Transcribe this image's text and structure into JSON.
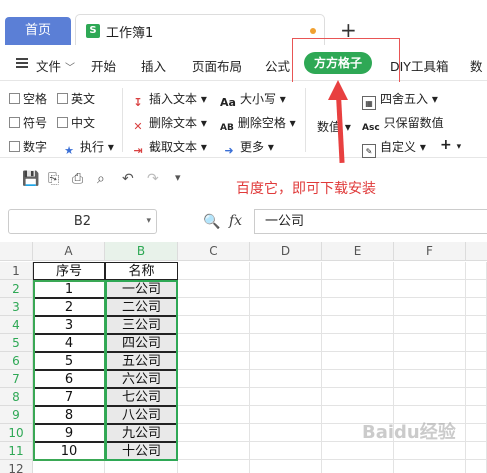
{
  "tabs": {
    "home": "首页",
    "doc_title": "工作簿1",
    "doc_icon": "S"
  },
  "menu": {
    "items": [
      "文件",
      "开始",
      "插入",
      "页面布局",
      "公式",
      "方方格子",
      "DIY工具箱",
      "数"
    ],
    "active": "方方格子"
  },
  "ribbon": {
    "checkboxes": [
      "空格",
      "英文",
      "符号",
      "中文",
      "数字"
    ],
    "exec": "执行",
    "text_ops": [
      "插入文本",
      "删除文本",
      "截取文本"
    ],
    "case_ops": [
      "大小写",
      "删除空格",
      "更多"
    ],
    "numeric": "数值",
    "round_ops": [
      "四舍五入",
      "只保留数值",
      "自定义"
    ]
  },
  "annotation": "百度它，即可下载安装",
  "formula_bar": {
    "cell_ref": "B2",
    "fx": "fx",
    "value": "一公司"
  },
  "sheet": {
    "columns": [
      "A",
      "B",
      "C",
      "D",
      "E",
      "F"
    ],
    "rows": [
      "1",
      "2",
      "3",
      "4",
      "5",
      "6",
      "7",
      "8",
      "9",
      "10",
      "11",
      "12"
    ],
    "header": [
      "序号",
      "名称"
    ],
    "data": [
      [
        "1",
        "一公司"
      ],
      [
        "2",
        "二公司"
      ],
      [
        "3",
        "三公司"
      ],
      [
        "4",
        "四公司"
      ],
      [
        "5",
        "五公司"
      ],
      [
        "6",
        "六公司"
      ],
      [
        "7",
        "七公司"
      ],
      [
        "8",
        "八公司"
      ],
      [
        "9",
        "九公司"
      ],
      [
        "10",
        "十公司"
      ]
    ]
  },
  "watermark": "Baidu经验",
  "colors": {
    "accent": "#2ea855",
    "home_tab": "#5b7fd6",
    "annotation": "#e03a3a"
  }
}
